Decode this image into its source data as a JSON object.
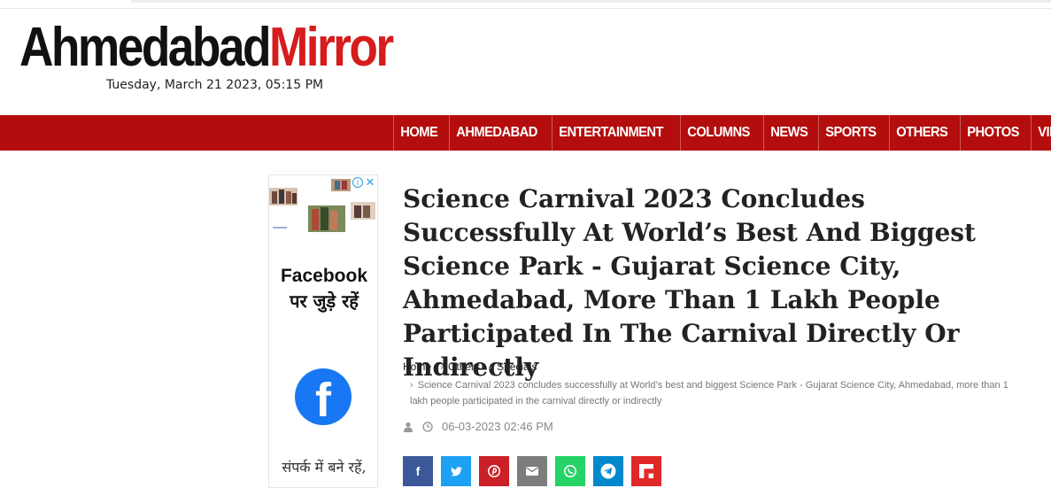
{
  "site": {
    "logo_part1": "Ahmedabad",
    "logo_part2": "Mirror",
    "date": "Tuesday, March 21 2023, 05:15 PM",
    "brand_red": "#b40d0d"
  },
  "nav": {
    "items": [
      "HOME",
      "AHMEDABAD",
      "ENTERTAINMENT",
      "COLUMNS",
      "NEWS",
      "SPORTS",
      "OTHERS",
      "PHOTOS",
      "VIDEOS"
    ]
  },
  "ad": {
    "title_line1": "Facebook",
    "title_line2": "पर जुड़े रहें",
    "logo_letter": "f",
    "bottom_text": "संपर्क में बने रहें,",
    "icons": [
      "info-icon",
      "close-icon"
    ]
  },
  "article": {
    "headline": "Science Carnival 2023 Concludes Successfully At World’s Best And Biggest Science Park - Gujarat Science City, Ahmedabad, More Than 1 Lakh People Participated In The Carnival Directly Or Indirectly",
    "breadcrumb": {
      "home": "Home",
      "others": "Others",
      "specials": "Specials",
      "current": "Science Carnival 2023 concludes successfully at World’s best and biggest Science Park - Gujarat Science City, Ahmedabad, more than 1 lakh people participated in the carnival directly or indirectly",
      "separator": "›"
    },
    "datetime": "06-03-2023 02:46 PM"
  },
  "share": {
    "buttons": [
      {
        "name": "facebook",
        "glyph": "f",
        "color": "#3b5998"
      },
      {
        "name": "twitter",
        "glyph": "🐦",
        "color": "#1da1f2"
      },
      {
        "name": "pinterest",
        "glyph": "P",
        "color": "#cb2027"
      },
      {
        "name": "email",
        "glyph": "✉",
        "color": "#7d7d7d"
      },
      {
        "name": "whatsapp",
        "glyph": "☏",
        "color": "#25d366"
      },
      {
        "name": "telegram",
        "glyph": "➤",
        "color": "#0088cc"
      },
      {
        "name": "flipboard",
        "glyph": "F",
        "color": "#e12828"
      }
    ]
  }
}
